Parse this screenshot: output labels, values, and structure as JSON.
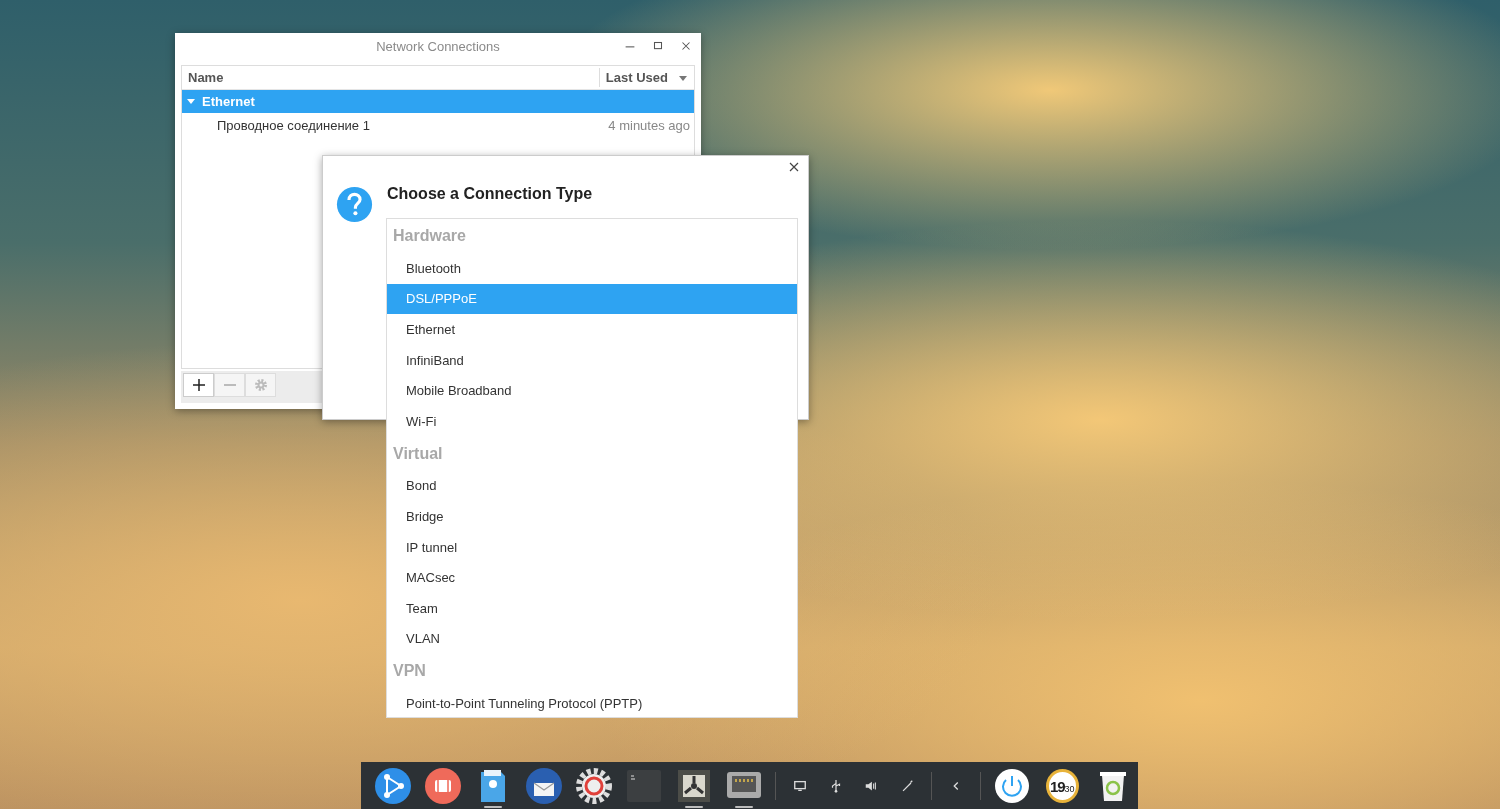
{
  "network_window": {
    "title": "Network Connections",
    "columns": [
      {
        "label": "Name"
      },
      {
        "label": "Last Used"
      }
    ],
    "groups": [
      {
        "label": "Ethernet",
        "expanded": true,
        "selected": true,
        "children": [
          {
            "name": "Проводное соединение 1",
            "last_used": "4 minutes ago",
            "selected": false
          }
        ]
      }
    ],
    "toolbar": [
      {
        "kind": "add",
        "disabled": false
      },
      {
        "kind": "remove",
        "disabled": true
      },
      {
        "kind": "settings",
        "disabled": true
      }
    ]
  },
  "dialog": {
    "title": "Choose a Connection Type",
    "sections": [
      {
        "label": "Hardware",
        "items": [
          {
            "label": "Bluetooth",
            "selected": false
          },
          {
            "label": "DSL/PPPoE",
            "selected": true
          },
          {
            "label": "Ethernet",
            "selected": false
          },
          {
            "label": "InfiniBand",
            "selected": false
          },
          {
            "label": "Mobile Broadband",
            "selected": false
          },
          {
            "label": "Wi-Fi",
            "selected": false
          }
        ]
      },
      {
        "label": "Virtual",
        "items": [
          {
            "label": "Bond",
            "selected": false
          },
          {
            "label": "Bridge",
            "selected": false
          },
          {
            "label": "IP tunnel",
            "selected": false
          },
          {
            "label": "MACsec",
            "selected": false
          },
          {
            "label": "Team",
            "selected": false
          },
          {
            "label": "VLAN",
            "selected": false
          }
        ]
      },
      {
        "label": "VPN",
        "items": [
          {
            "label": "Point-to-Point Tunneling Protocol (PPTP)",
            "selected": false
          }
        ]
      }
    ]
  },
  "dock": {
    "apps": [
      {
        "kind": "launcher",
        "running": false
      },
      {
        "kind": "recorder",
        "running": false
      },
      {
        "kind": "files",
        "running": true
      },
      {
        "kind": "mail",
        "running": false
      },
      {
        "kind": "settings",
        "running": false
      },
      {
        "kind": "terminal",
        "running": false
      },
      {
        "kind": "fan",
        "running": true
      },
      {
        "kind": "network",
        "running": true
      }
    ],
    "tray": [
      {
        "kind": "display"
      },
      {
        "kind": "usb"
      },
      {
        "kind": "volume"
      },
      {
        "kind": "pen"
      },
      {
        "kind": "collapse"
      }
    ],
    "clock": {
      "hours": "19",
      "minutes": "30"
    }
  }
}
